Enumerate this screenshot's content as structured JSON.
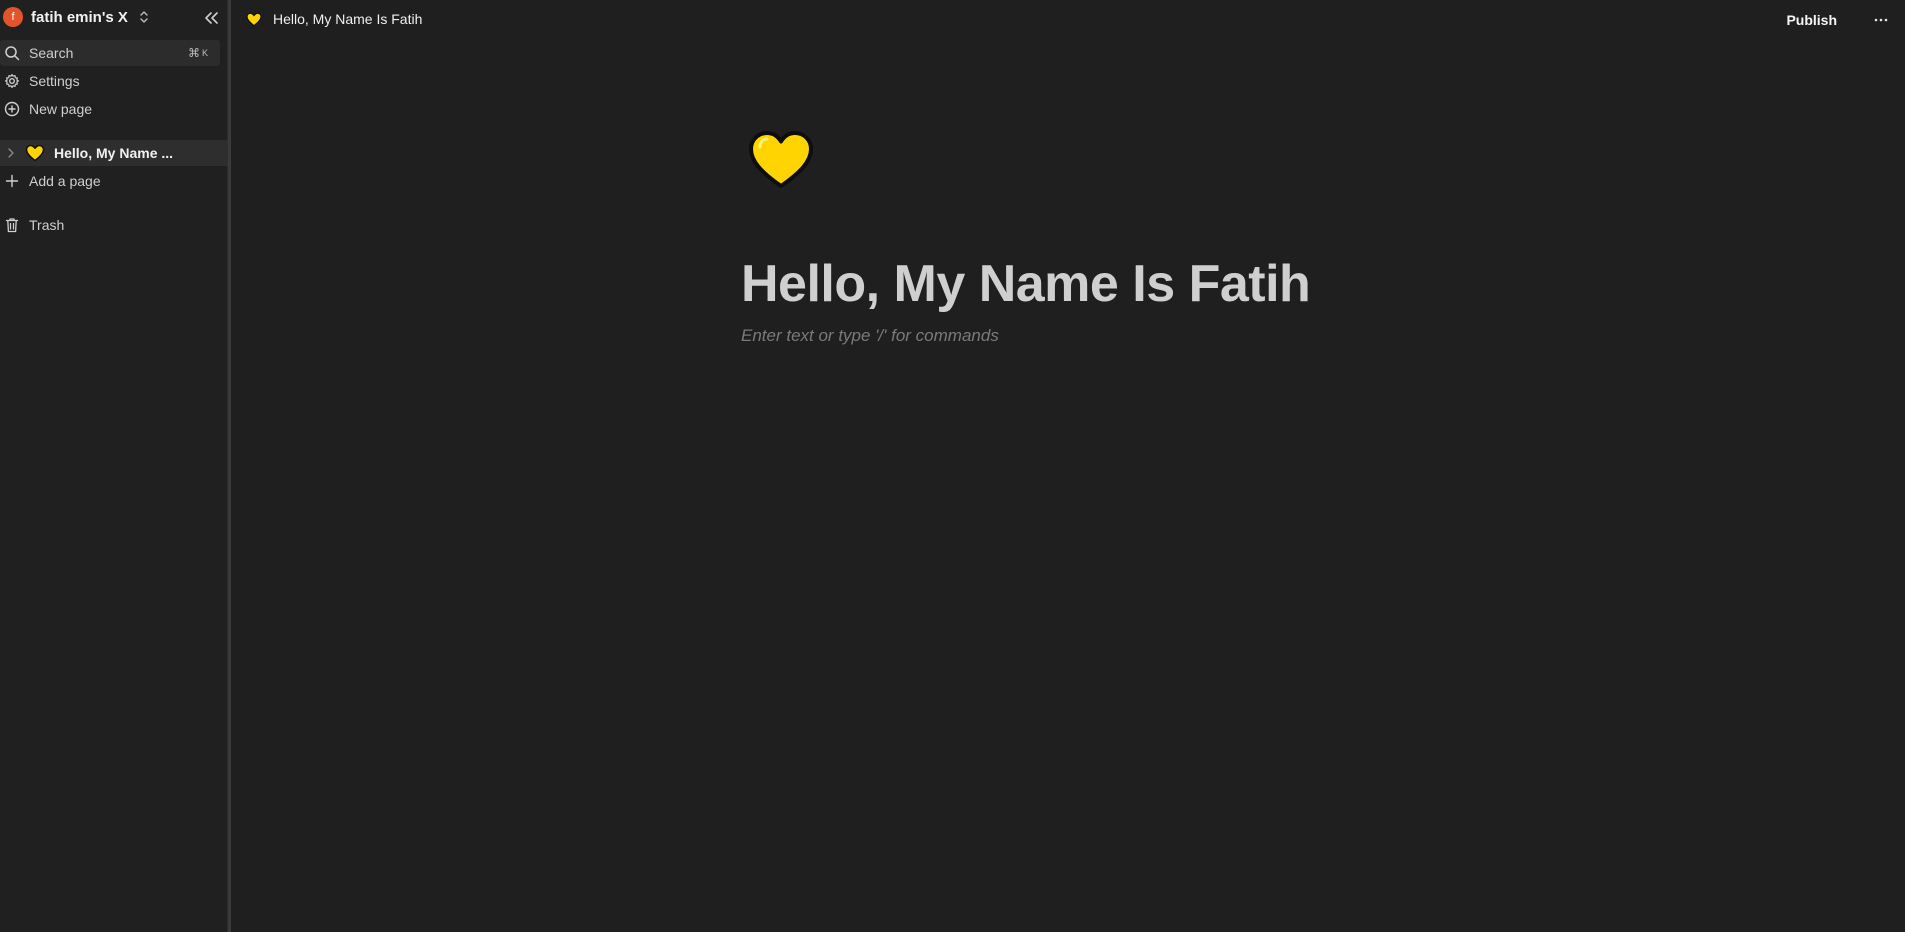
{
  "workspace": {
    "avatar_letter": "f",
    "name": "fatih emin's X"
  },
  "sidebar": {
    "search_label": "Search",
    "search_shortcut_cmd": "⌘",
    "search_shortcut_key": "K",
    "settings_label": "Settings",
    "new_page_label": "New page",
    "pages": [
      {
        "label": "Hello, My Name ...",
        "emoji": "yellow-heart"
      }
    ],
    "add_page_label": "Add a page",
    "trash_label": "Trash"
  },
  "topbar": {
    "breadcrumb_title": "Hello, My Name Is Fatih",
    "publish_label": "Publish",
    "more_label": "···"
  },
  "page": {
    "icon": "yellow-heart",
    "title": "Hello, My Name Is Fatih",
    "placeholder": "Enter text or type '/' for commands"
  },
  "colors": {
    "background": "#1f1f1f",
    "avatar": "#e3542a",
    "heart": "#ffd400"
  }
}
